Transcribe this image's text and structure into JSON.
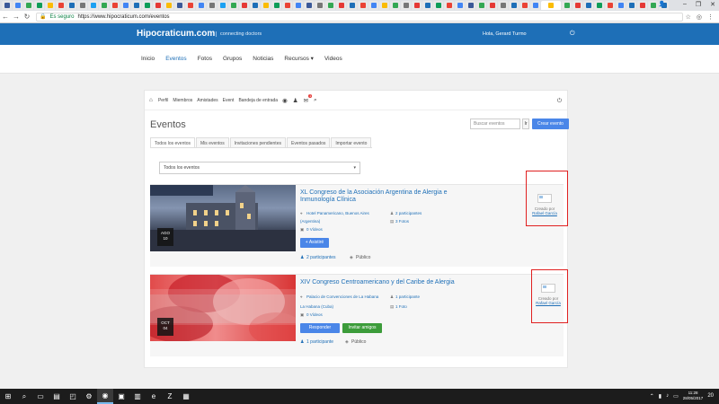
{
  "browser": {
    "omnibox": {
      "secure_label": "Es seguro",
      "url": "https://www.hipocraticum.com/eventos"
    },
    "tab_colors": [
      "#3b5998",
      "#4285f4",
      "#34a853",
      "#0f9d58",
      "#fbbc05",
      "#ea4335",
      "#1e6fb7",
      "#777777",
      "#1da1f2",
      "#34a853",
      "#ea4335",
      "#4285f4",
      "#1e6fb7",
      "#0f9d58",
      "#e53935",
      "#fbbc05",
      "#3b5998",
      "#ea4335",
      "#4285f4",
      "#777777",
      "#1da1f2",
      "#34a853",
      "#e53935",
      "#1e6fb7",
      "#fbbc05",
      "#0f9d58",
      "#ea4335",
      "#4285f4",
      "#3b5998",
      "#777777",
      "#34a853",
      "#e53935",
      "#1e6fb7",
      "#ea4335",
      "#4285f4",
      "#fbbc05",
      "#34a853",
      "#777777",
      "#e53935",
      "#1e6fb7",
      "#0f9d58",
      "#ea4335",
      "#4285f4",
      "#3b5998",
      "#34a853",
      "#e53935",
      "#777777",
      "#1e6fb7",
      "#ea4335",
      "#4285f4",
      "#fbbc05",
      "#34a853",
      "#e53935",
      "#1e6fb7",
      "#0f9d58",
      "#ea4335",
      "#4285f4",
      "#1e6fb7",
      "#e53935",
      "#34a853",
      "#1e6fb7"
    ]
  },
  "site": {
    "brand": "Hipocraticum.com",
    "tagline": "connecting doctors",
    "greeting": "Hola, Gerard Turmo"
  },
  "mainnav": {
    "items": [
      {
        "label": "Inicio"
      },
      {
        "label": "Eventos"
      },
      {
        "label": "Fotos"
      },
      {
        "label": "Grupos"
      },
      {
        "label": "Noticias"
      },
      {
        "label": "Recursos ▾"
      },
      {
        "label": "Videos"
      }
    ]
  },
  "subnav": {
    "items": [
      "Perfil",
      "Miembros",
      "Amistades",
      "Event",
      "Bandeja de entrada"
    ],
    "notification_count": "1"
  },
  "events_page": {
    "title": "Eventos",
    "search_placeholder": "Buscar eventos",
    "search_button": "Ir",
    "create_button": "Crear evento",
    "tabs": [
      "Todos los eventos",
      "Mis eventos",
      "Invitaciones pendientes",
      "Eventos pasados",
      "Importar evento"
    ],
    "filter_value": "Todos los eventos"
  },
  "events": [
    {
      "title": "XL Congreso de la Asociación Argentina de Alergia e Inmunología Clínica",
      "month": "AGO",
      "day": "10",
      "location": "Hotel Panamericano, Buenos Aires",
      "country": "(Argentina)",
      "participants_meta": "2 participantes",
      "photos": "3 Fotos",
      "videos": "0 Vídeos",
      "actions": [
        "+ Asistiré"
      ],
      "participants_footer": "2 participantes",
      "visibility": "Público",
      "created_by_label": "Creado por",
      "creator": "Rafael García"
    },
    {
      "title": "XIV Congreso Centroamericano y del Caribe de Alergia",
      "month": "OCT",
      "day": "04",
      "location": "Palacio de Convenciones de La Habana",
      "country": "La Habana (Cuba)",
      "participants_meta": "1 participante",
      "photos": "1 Foto",
      "videos": "0 Vídeos",
      "actions": [
        "Responder",
        "Invitar amigos"
      ],
      "participants_footer": "1 participante",
      "visibility": "Público",
      "created_by_label": "Creado por",
      "creator": "Rafael García"
    }
  ],
  "taskbar": {
    "time": "11:28",
    "date": "28/05/2017",
    "notif_count": "20"
  }
}
